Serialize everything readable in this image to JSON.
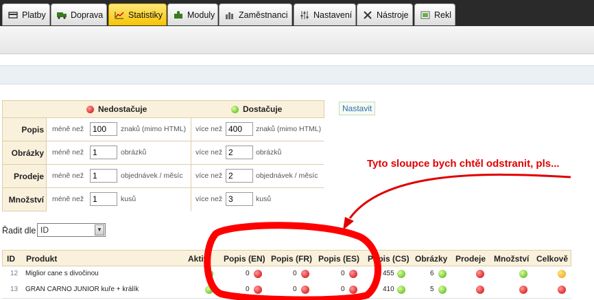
{
  "tabs": [
    {
      "label": "Platby",
      "icon": "card-icon"
    },
    {
      "label": "Doprava",
      "icon": "truck-icon"
    },
    {
      "label": "Statistiky",
      "icon": "chart-icon",
      "active": true
    },
    {
      "label": "Moduly",
      "icon": "puzzle-icon"
    },
    {
      "label": "Zaměstnanci",
      "icon": "people-icon"
    },
    {
      "label": "Nastavení",
      "icon": "sliders-icon"
    },
    {
      "label": "Nástroje",
      "icon": "tools-icon"
    },
    {
      "label": "Rekl",
      "icon": "ad-icon"
    }
  ],
  "thresholds": {
    "header_bad": "Nedostačuje",
    "header_good": "Dostačuje",
    "less_than": "méně než",
    "more_than": "více než",
    "rows": [
      {
        "label": "Popis",
        "bad_value": "100",
        "good_value": "400",
        "unit": "znaků (mimo HTML)"
      },
      {
        "label": "Obrázky",
        "bad_value": "1",
        "good_value": "2",
        "unit": "obrázků"
      },
      {
        "label": "Prodeje",
        "bad_value": "1",
        "good_value": "2",
        "unit": "objednávek / měsíc"
      },
      {
        "label": "Množství",
        "bad_value": "1",
        "good_value": "3",
        "unit": "kusů"
      }
    ],
    "set_button": "Nastavit"
  },
  "sort": {
    "label": "Řadit dle",
    "value": "ID"
  },
  "annotation": "Tyto sloupce bych chtěl odstranit, pls...",
  "products": {
    "columns": [
      "ID",
      "Produkt",
      "Aktiv",
      "Popis (EN)",
      "Popis (FR)",
      "Popis (ES)",
      "Popis (CS)",
      "Obrázky",
      "Prodeje",
      "Množství",
      "Celkově"
    ],
    "rows": [
      {
        "id": "12",
        "name": "Miglior cane s divočinou",
        "en": "0",
        "fr": "0",
        "es": "0",
        "cs": "455",
        "img": "6"
      },
      {
        "id": "13",
        "name": "GRAN CARNO JUNIOR kuře + králík",
        "en": "0",
        "fr": "0",
        "es": "0",
        "cs": "410",
        "img": "5"
      }
    ]
  },
  "colors": {
    "accent": "#f6c400",
    "annotation": "#e00000"
  }
}
